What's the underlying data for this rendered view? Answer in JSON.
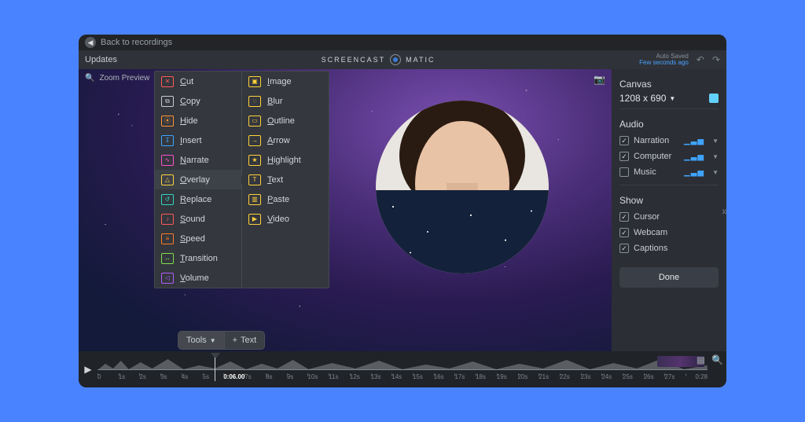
{
  "breadcrumb": {
    "back_label": "Back to recordings"
  },
  "menubar": {
    "updates_label": "Updates",
    "brand_left": "SCREENCAST",
    "brand_right": "MATIC",
    "autosave_title": "Auto Saved",
    "autosave_sub": "Few seconds ago"
  },
  "preview": {
    "zoom_placeholder": "Zoom Preview"
  },
  "tools_pill": {
    "tools_label": "Tools",
    "text_label": "Text"
  },
  "tools_menu": {
    "items": [
      {
        "label": "Cut",
        "color": "c-red",
        "glyph": "✕"
      },
      {
        "label": "Copy",
        "color": "c-grey",
        "glyph": "⧉"
      },
      {
        "label": "Hide",
        "color": "c-orange",
        "glyph": "⦿"
      },
      {
        "label": "Insert",
        "color": "c-blue",
        "glyph": "↧"
      },
      {
        "label": "Narrate",
        "color": "c-magenta",
        "glyph": "∿"
      },
      {
        "label": "Overlay",
        "color": "c-yellow",
        "glyph": "△",
        "active": true
      },
      {
        "label": "Replace",
        "color": "c-teal",
        "glyph": "↺"
      },
      {
        "label": "Sound",
        "color": "c-red",
        "glyph": "♪"
      },
      {
        "label": "Speed",
        "color": "c-dorange",
        "glyph": "≡"
      },
      {
        "label": "Transition",
        "color": "c-lgreen",
        "glyph": "↔"
      },
      {
        "label": "Volume",
        "color": "c-purple",
        "glyph": "◁"
      }
    ],
    "overlay_items": [
      {
        "label": "Image",
        "glyph": "▣"
      },
      {
        "label": "Blur",
        "glyph": "◌"
      },
      {
        "label": "Outline",
        "glyph": "▭"
      },
      {
        "label": "Arrow",
        "glyph": "→"
      },
      {
        "label": "Highlight",
        "glyph": "★"
      },
      {
        "label": "Text",
        "glyph": "T"
      },
      {
        "label": "Paste",
        "glyph": "▥"
      },
      {
        "label": "Video",
        "glyph": "▶"
      }
    ]
  },
  "sidebar": {
    "canvas_title": "Canvas",
    "canvas_dim": "1208 x 690",
    "audio_title": "Audio",
    "audio_items": [
      {
        "label": "Narration",
        "checked": true,
        "bars": true
      },
      {
        "label": "Computer",
        "checked": true,
        "bars": true
      },
      {
        "label": "Music",
        "checked": false,
        "bars": true
      }
    ],
    "show_title": "Show",
    "show_items": [
      {
        "label": "Cursor",
        "checked": true
      },
      {
        "label": "Webcam",
        "checked": true
      },
      {
        "label": "Captions",
        "checked": true
      }
    ],
    "done_label": "Done"
  },
  "timeline": {
    "current_label": "0:06.00",
    "end_label": "0:28",
    "ticks": [
      "0",
      "1s",
      "2s",
      "3s",
      "4s",
      "5s",
      "0:06.00",
      "7s",
      "8s",
      "9s",
      "10s",
      "11s",
      "12s",
      "13s",
      "14s",
      "15s",
      "16s",
      "17s",
      "18s",
      "19s",
      "20s",
      "21s",
      "22s",
      "23s",
      "24s",
      "25s",
      "26s",
      "27s"
    ]
  }
}
